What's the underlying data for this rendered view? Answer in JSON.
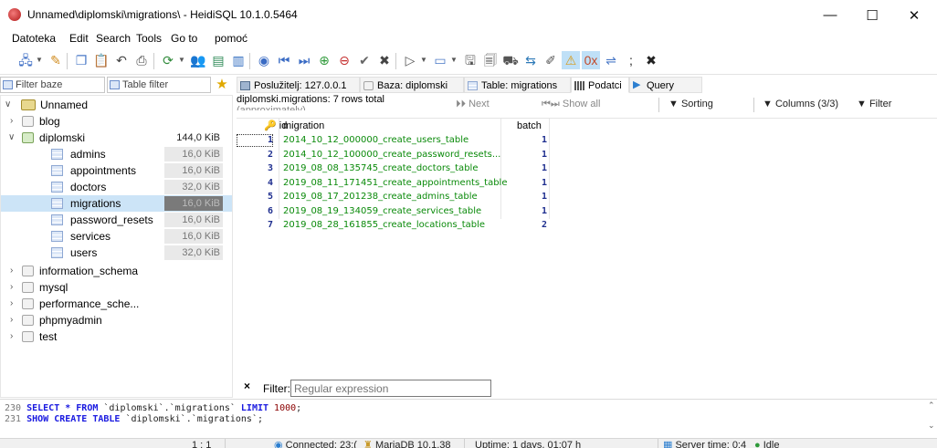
{
  "window": {
    "title": "Unnamed\\diplomski\\migrations\\ - HeidiSQL 10.1.0.5464",
    "minimize": "—",
    "maximize": "☐",
    "close": "✕"
  },
  "menu": [
    "Datoteka",
    "Edit",
    "Search",
    "Tools",
    "Go to",
    "pomoć"
  ],
  "left_filters": {
    "filter_db": "Filter baze",
    "table_filter": "Table filter"
  },
  "tree": {
    "root": "Unnamed",
    "items": [
      {
        "label": "blog",
        "size": ""
      },
      {
        "label": "diplomski",
        "size": "144,0 KiB"
      }
    ],
    "tables": [
      {
        "label": "admins",
        "size": "16,0 KiB"
      },
      {
        "label": "appointments",
        "size": "16,0 KiB"
      },
      {
        "label": "doctors",
        "size": "32,0 KiB"
      },
      {
        "label": "migrations",
        "size": "16,0 KiB"
      },
      {
        "label": "password_resets",
        "size": "16,0 KiB"
      },
      {
        "label": "services",
        "size": "16,0 KiB"
      },
      {
        "label": "users",
        "size": "32,0 KiB"
      }
    ],
    "other_dbs": [
      "information_schema",
      "mysql",
      "performance_sche...",
      "phpmyadmin",
      "test"
    ]
  },
  "tabs": [
    {
      "label": "Poslužitelj: 127.0.0.1"
    },
    {
      "label": "Baza: diplomski"
    },
    {
      "label": "Table: migrations"
    },
    {
      "label": "Podatci"
    },
    {
      "label": "Query"
    }
  ],
  "data_header": {
    "rows_total": "diplomski.migrations: 7 rows total",
    "rows_total_2": "(approximately)",
    "next": "Next",
    "show_all": "Show all",
    "sorting": "Sorting",
    "columns": "Columns (3/3)",
    "filter": "Filter"
  },
  "grid": {
    "columns": [
      "id",
      "migration",
      "batch"
    ],
    "rows": [
      {
        "id": "1",
        "migration": "2014_10_12_000000_create_users_table",
        "batch": "1"
      },
      {
        "id": "2",
        "migration": "2014_10_12_100000_create_password_resets...",
        "batch": "1"
      },
      {
        "id": "3",
        "migration": "2019_08_08_135745_create_doctors_table",
        "batch": "1"
      },
      {
        "id": "4",
        "migration": "2019_08_11_171451_create_appointments_table",
        "batch": "1"
      },
      {
        "id": "5",
        "migration": "2019_08_17_201238_create_admins_table",
        "batch": "1"
      },
      {
        "id": "6",
        "migration": "2019_08_19_134059_create_services_table",
        "batch": "1"
      },
      {
        "id": "7",
        "migration": "2019_08_28_161855_create_locations_table",
        "batch": "2"
      }
    ]
  },
  "filter_bar": {
    "close": "×",
    "label": "Filter:",
    "placeholder": "Regular expression"
  },
  "sql_log": [
    {
      "num": "230",
      "a": "SELECT * FROM ",
      "b": "`diplomski`.`migrations`",
      "c": " LIMIT ",
      "d": "1000",
      "e": ";"
    },
    {
      "num": "231",
      "a": "SHOW CREATE TABLE ",
      "b": "`diplomski`.`migrations`",
      "c": ";",
      "d": "",
      "e": ""
    }
  ],
  "status": {
    "pos": "1 : 1",
    "connected": "Connected: 23:(",
    "server": "MariaDB 10.1.38",
    "uptime": "Uptime: 1 days, 01:07 h",
    "server_time": "Server time: 0:4",
    "idle": "Idle"
  }
}
